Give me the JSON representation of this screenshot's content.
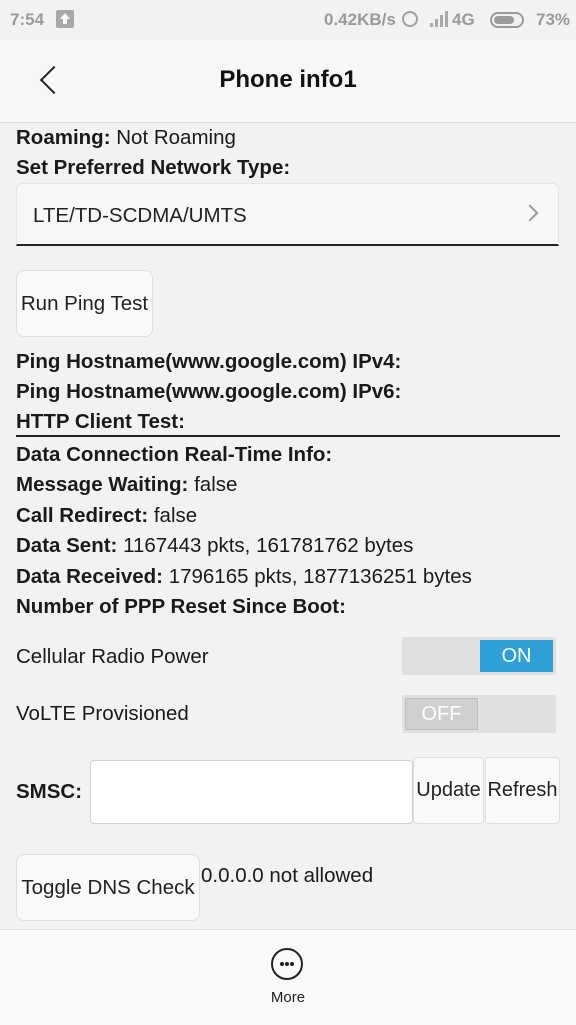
{
  "status": {
    "time": "7:54",
    "net_speed": "0.42KB/s",
    "network": "4G",
    "battery": "73%"
  },
  "header": {
    "title": "Phone info1"
  },
  "roaming": {
    "label": "Roaming:",
    "value": "Not Roaming"
  },
  "preferred_network": {
    "label": "Set Preferred Network Type:",
    "value": "LTE/TD-SCDMA/UMTS"
  },
  "ping": {
    "button": "Run Ping Test",
    "ipv4_label": "Ping Hostname(www.google.com) IPv4:",
    "ipv6_label": "Ping Hostname(www.google.com) IPv6:",
    "http_label": "HTTP Client Test:"
  },
  "info": {
    "realtime_label": "Data Connection Real-Time Info:",
    "message_waiting_label": "Message Waiting:",
    "message_waiting_value": "false",
    "call_redirect_label": "Call Redirect:",
    "call_redirect_value": "false",
    "data_sent_label": "Data Sent:",
    "data_sent_value": "1167443 pkts, 161781762 bytes",
    "data_received_label": "Data Received:",
    "data_received_value": "1796165 pkts, 1877136251 bytes",
    "ppp_reset_label": "Number of PPP Reset Since Boot:"
  },
  "toggles": {
    "cellular_label": "Cellular Radio Power",
    "cellular_state": "ON",
    "volte_label": "VoLTE Provisioned",
    "volte_state": "OFF"
  },
  "smsc": {
    "label": "SMSC:",
    "value": "",
    "update_button": "Update",
    "refresh_button": "Refresh"
  },
  "dns": {
    "button": "Toggle DNS Check",
    "status": "0.0.0.0 not allowed"
  },
  "bottom": {
    "more_label": "More"
  }
}
